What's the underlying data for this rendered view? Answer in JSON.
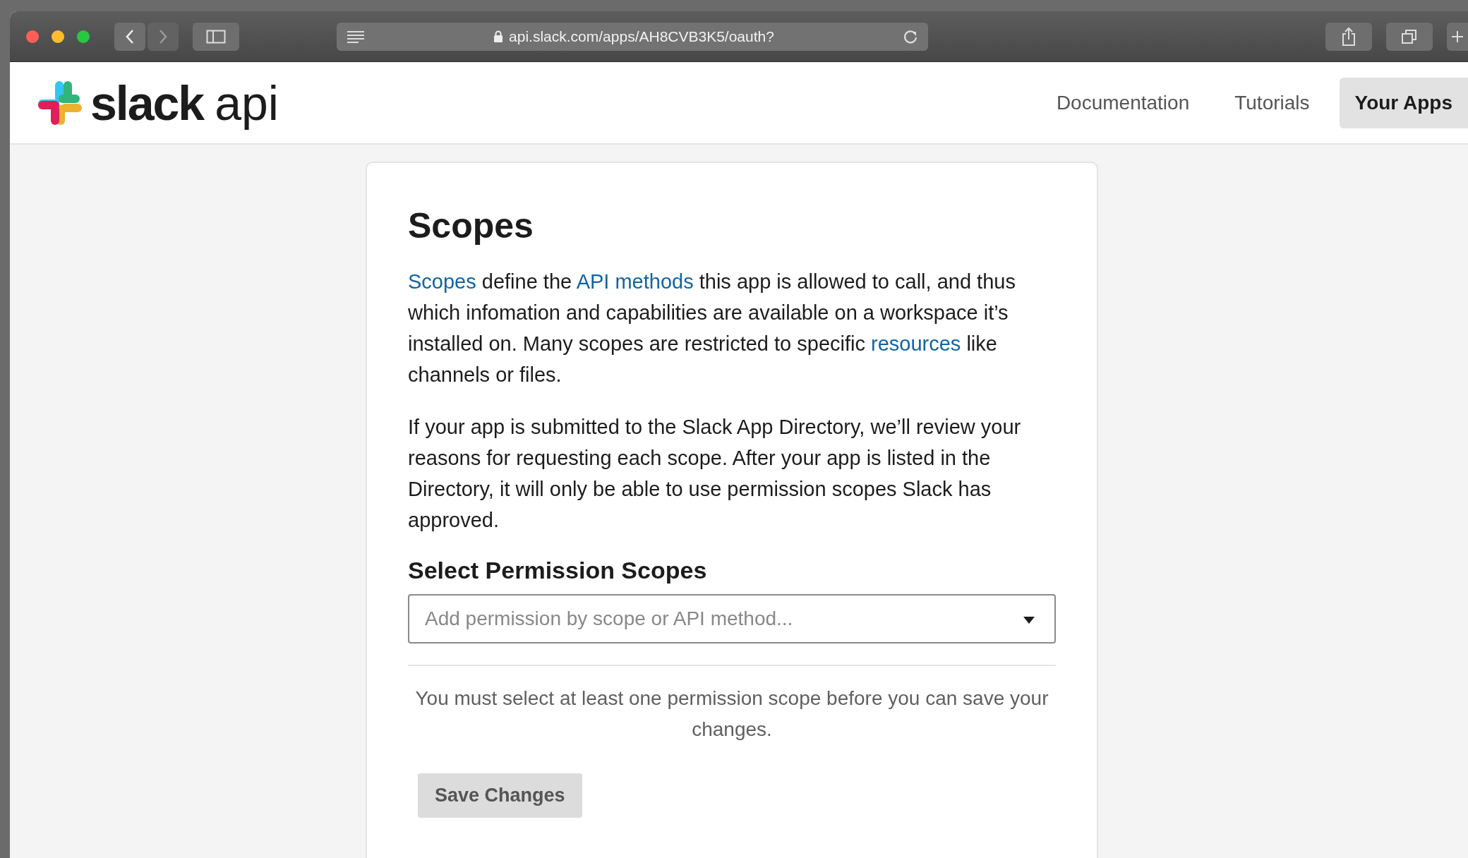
{
  "browser": {
    "url": "api.slack.com/apps/AH8CVB3K5/oauth?"
  },
  "header": {
    "logo_word": "slack",
    "logo_suffix": "api",
    "nav": [
      {
        "label": "Documentation",
        "selected": false
      },
      {
        "label": "Tutorials",
        "selected": false
      },
      {
        "label": "Your Apps",
        "selected": true
      }
    ]
  },
  "card": {
    "title": "Scopes",
    "intro": [
      {
        "kind": "link",
        "text": "Scopes"
      },
      {
        "kind": "text",
        "text": " define the "
      },
      {
        "kind": "link",
        "text": "API methods"
      },
      {
        "kind": "text",
        "text": " this app is allowed to call, and thus which infomation and capabilities are available on a workspace it’s installed on. Many scopes are restricted to specific "
      },
      {
        "kind": "link",
        "text": "resources"
      },
      {
        "kind": "text",
        "text": " like channels or files."
      }
    ],
    "review_text": "If your app is submitted to the Slack App Directory, we’ll review your reasons for requesting each scope. After your app is listed in the Directory, it will only be able to use permission scopes Slack has approved.",
    "section_title": "Select Permission Scopes",
    "select": {
      "placeholder": "Add permission by scope or API method..."
    },
    "notice": "You must select at least one permission scope before you can save your changes.",
    "save_button": {
      "label": "Save Changes",
      "disabled": true
    }
  }
}
